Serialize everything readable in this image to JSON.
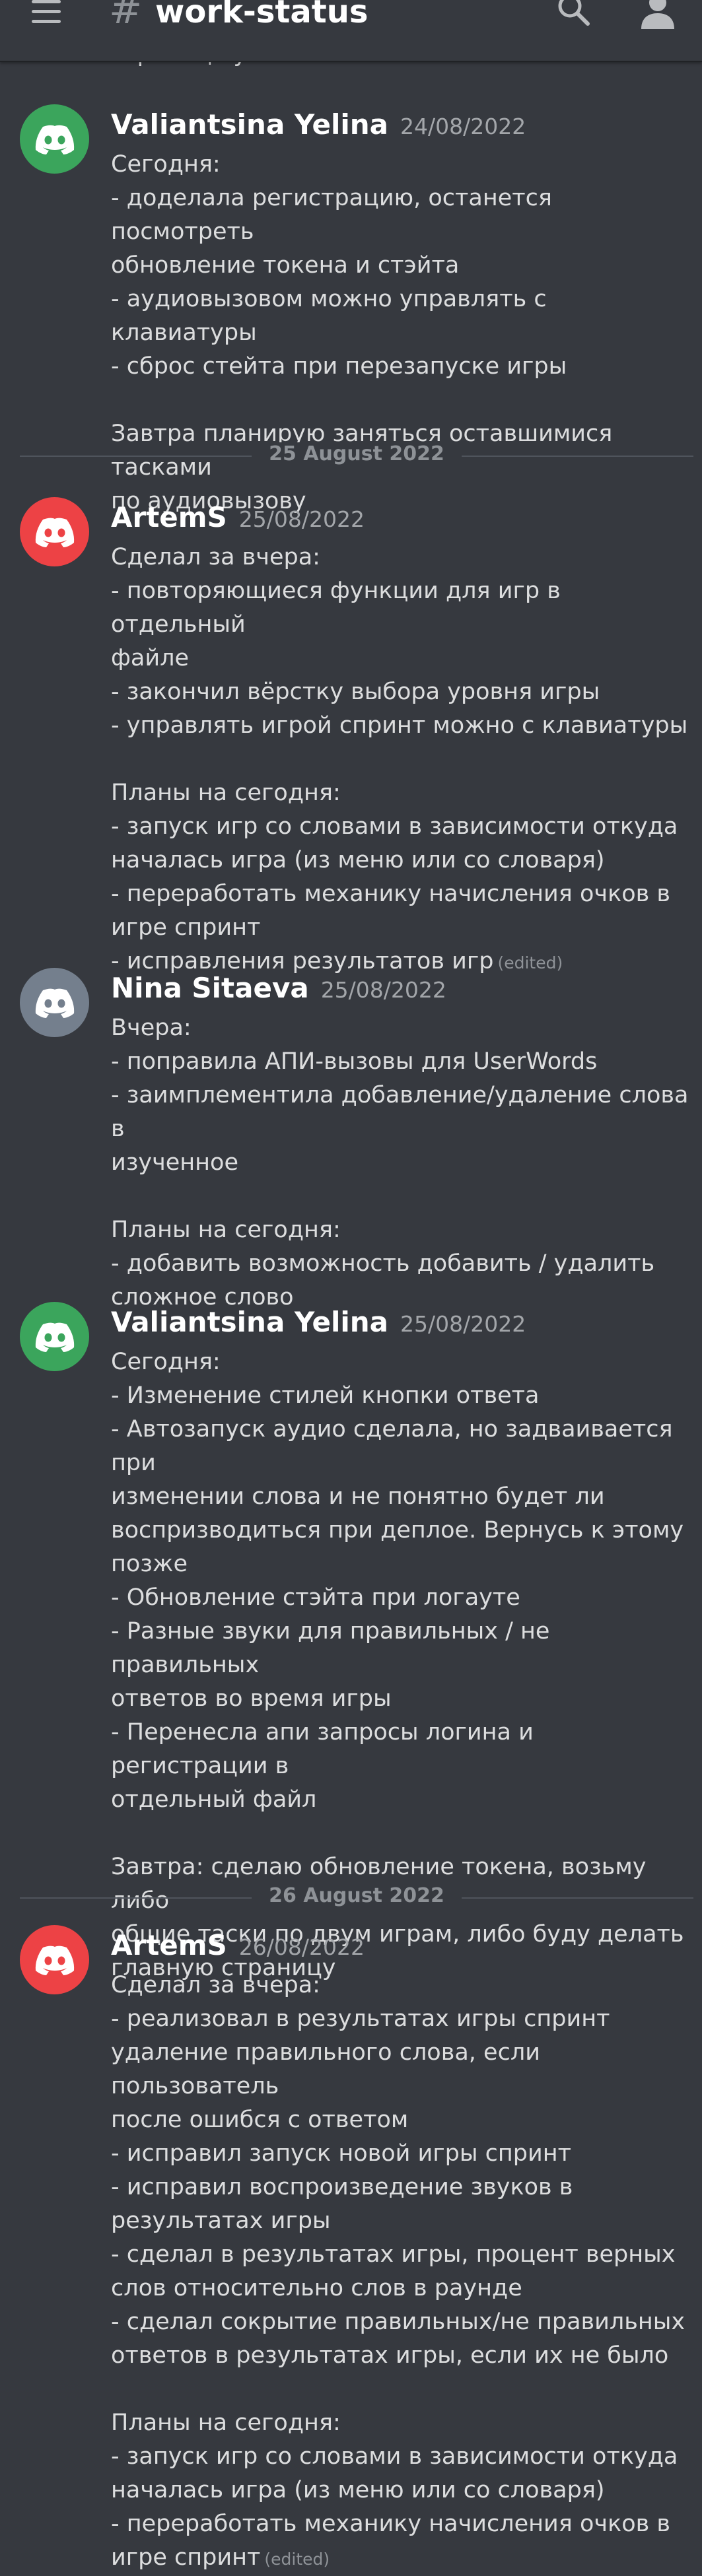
{
  "channel": {
    "name": "work-status"
  },
  "cut_text": "странице учебника",
  "colors": {
    "green": "#3ba55c",
    "red": "#ed4245",
    "grey": "#747f8d"
  },
  "dividers": [
    "25 August 2022",
    "26 August 2022"
  ],
  "messages": [
    {
      "author": "Valiantsina Yelina",
      "timestamp": "24/08/2022",
      "avatar_color": "green",
      "lines": [
        "Сегодня:",
        "- доделала регистрацию, останется посмотреть",
        "обновление токена и стэйта",
        "- аудиовызовом можно управлять с клавиатуры",
        "- сброс стейта при перезапуске игры",
        "",
        "Завтра планирую заняться оставшимися тасками",
        "по аудиовызову"
      ]
    },
    {
      "author": "ArtemS",
      "timestamp": "25/08/2022",
      "avatar_color": "red",
      "lines": [
        "Сделал за вчера:",
        "- повторяющиеся функции для игр в отдельный",
        "файле",
        "- закончил вёрстку выбора уровня игры",
        "- управлять игрой спринт можно с клавиатуры",
        "",
        "Планы на сегодня:",
        "- запуск игр со словами в зависимости откуда",
        "началась игра (из меню или со словаря)",
        "- переработать механику начисления очков в",
        "игре спринт",
        "- исправления результатов игр"
      ],
      "edited": "(edited)"
    },
    {
      "author": "Nina Sitaeva",
      "timestamp": "25/08/2022",
      "avatar_color": "grey",
      "lines": [
        "Вчера:",
        "- поправила АПИ-вызовы для UserWords",
        "- заимплементила добавление/удаление слова в",
        "изученное",
        "",
        "Планы на сегодня:",
        "- добавить возможность добавить / удалить",
        "сложное слово"
      ]
    },
    {
      "author": "Valiantsina Yelina",
      "timestamp": "25/08/2022",
      "avatar_color": "green",
      "lines": [
        "Сегодня:",
        "- Изменение стилей кнопки ответа",
        "- Автозапуск аудио сделала, но задваивается при",
        "изменении слова и не понятно будет ли",
        "воспризводиться при деплое. Вернусь к этому",
        "позже",
        "- Обновление стэйта при логауте",
        "- Разные звуки для правильных / не правильных",
        "ответов во время игры",
        "- Перенесла апи запросы логина и регистрации в",
        "отдельный файл",
        "",
        "Завтра: сделаю обновление токена, возьму либо",
        "общие таски по двум играм, либо буду делать",
        "главную страницу"
      ]
    },
    {
      "author": "ArtemS",
      "timestamp": "26/08/2022",
      "avatar_color": "red",
      "lines": [
        "Сделал за вчера:",
        "- реализовал в результатах игры спринт",
        "удаление правильного слова, если пользователь",
        "после ошибся с ответом",
        "- исправил запуск новой игры спринт",
        "- исправил воспроизведение звуков в",
        "результатах игры",
        "- сделал в результатах игры, процент верных",
        "слов относительно слов в раунде",
        "- сделал сокрытие правильных/не правильных",
        "ответов в результатах игры, если их не было",
        "",
        "Планы на сегодня:",
        "- запуск игр со словами в зависимости откуда",
        "началась игра (из меню или со словаря)",
        "- переработать механику начисления очков в",
        "игре спринт"
      ],
      "edited": "(edited)"
    }
  ]
}
